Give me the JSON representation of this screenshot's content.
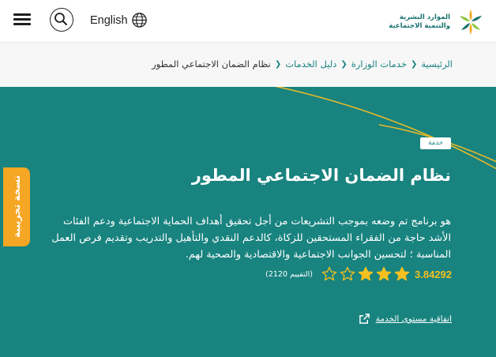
{
  "header": {
    "language_label": "English",
    "logo": {
      "line1": "الموارد البشرية",
      "line2": "والتنمية الاجتماعية",
      "color": "#17706e"
    },
    "icons": {
      "menu": "menu-icon",
      "search": "search-icon",
      "globe": "globe-icon"
    }
  },
  "breadcrumb": {
    "items": [
      {
        "label": "الرئيسية"
      },
      {
        "label": "خدمات الوزارة"
      },
      {
        "label": "دليل الخدمات"
      }
    ],
    "current": "نظام الضمان الاجتماعي المطور"
  },
  "service": {
    "badge": "خدمة",
    "title": "نظام الضمان الاجتماعي المطور",
    "description": "هو برنامج تم وضعه بموجب التشريعات من أجل تحقيق أهداف الحماية الاجتماعية ودعم الفئات الأشد حاجة من الفقراء المستحقين للزكاة، كالدعم النقدي والتأهيل والتدريب وتقديم فرص العمل المناسبة ؛ لتحسين الجوانب الاجتماعية والاقتصادية والصحية لهم.",
    "rating_value": "3.84292",
    "rating_count_text": "(التقييم 2120)",
    "stars": {
      "max": 5,
      "filled": 3
    },
    "sla_link": "اتفاقية مستوى الخدمة"
  },
  "side_tab": {
    "label": "نسخة تجريبية"
  },
  "colors": {
    "hero_bg": "#18837f",
    "accent_teal": "#1a8382",
    "star_gold": "#f6c021",
    "side_tab": "#f5a623",
    "arc": "#e6b92a"
  }
}
